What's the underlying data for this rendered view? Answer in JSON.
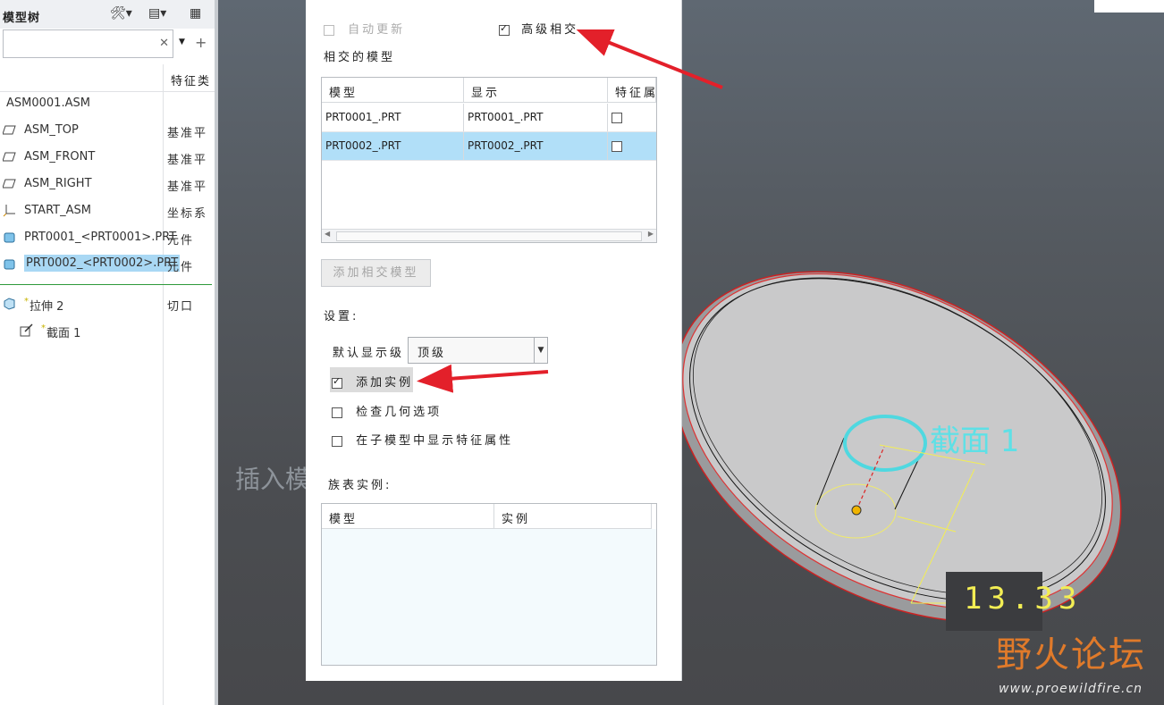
{
  "tree": {
    "title": "模型树",
    "column_feature": "特征类",
    "search_placeholder": "",
    "items": [
      {
        "name": "ASM0001.ASM",
        "type": ""
      },
      {
        "name": "ASM_TOP",
        "type": "基准平"
      },
      {
        "name": "ASM_FRONT",
        "type": "基准平"
      },
      {
        "name": "ASM_RIGHT",
        "type": "基准平"
      },
      {
        "name": "START_ASM",
        "type": "坐标系"
      },
      {
        "name": "PRT0001_<PRT0001>.PRT",
        "type": "元件"
      },
      {
        "name": "PRT0002_<PRT0002>.PRT",
        "type": "元件"
      }
    ],
    "features": [
      {
        "name": "拉伸 2",
        "type": "切口"
      },
      {
        "name": "截面 1",
        "type": ""
      }
    ]
  },
  "dialog": {
    "auto_update": "自动更新",
    "advanced_intersect": "高级相交",
    "intersect_models": "相交的模型",
    "table": {
      "col_model": "模型",
      "col_display": "显示",
      "col_feature": "特征属",
      "rows": [
        {
          "model": "PRT0001_.PRT",
          "display": "PRT0001_.PRT"
        },
        {
          "model": "PRT0002_.PRT",
          "display": "PRT0002_.PRT"
        }
      ]
    },
    "add_intersect_button": "添加相交模型",
    "settings_label": "设置:",
    "default_display_label": "默认显示级",
    "default_display_value": "顶级",
    "add_instance": "添加实例",
    "check_geometry": "检查几何选项",
    "show_feature_props": "在子模型中显示特征属性",
    "family_label": "族表实例:",
    "family_table": {
      "col_model": "模型",
      "col_instance": "实例"
    }
  },
  "viewport": {
    "insert_text": "插入模",
    "section_label": "截面 1",
    "dimension": "13.33",
    "watermark": "野火论坛",
    "watermark_url": "www.proewildfire.cn"
  },
  "colors": {
    "selection": "#a9d8f4",
    "annotation_arrow": "#e3202a",
    "dimension": "#f3ee54",
    "section": "#5ee0e6"
  }
}
